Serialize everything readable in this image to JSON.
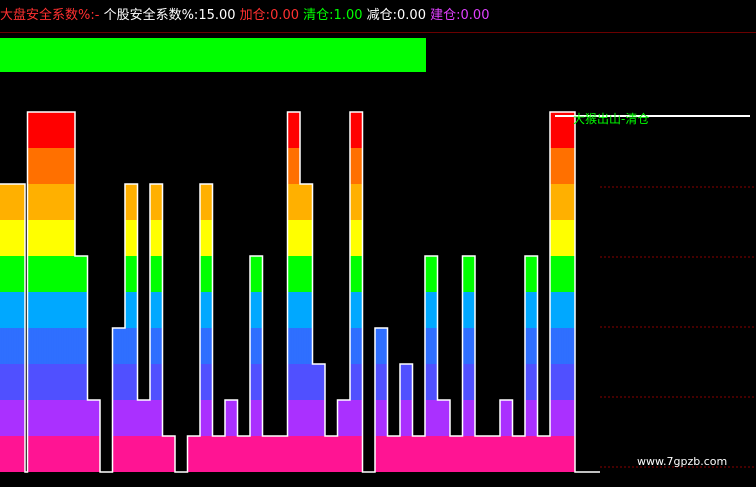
{
  "header": {
    "item1": {
      "label": "大盘安全系数%:",
      "value": "-",
      "color": "#ff3030"
    },
    "item2": {
      "label": "个股安全系数%:",
      "value": "15.00",
      "color": "#ffffff"
    },
    "item3": {
      "label": "加仓:",
      "value": "0.00",
      "color": "#ff3030"
    },
    "item4": {
      "label": "清仓:",
      "value": "1.00",
      "color": "#00ff00"
    },
    "item5": {
      "label": "减仓:",
      "value": "0.00",
      "color": "#ffffff"
    },
    "item6": {
      "label": "建仓:",
      "value": "0.00",
      "color": "#e040ff"
    }
  },
  "top_bar_color": "#00ff00",
  "band_colors": [
    "#ff1493",
    "#aa30ff",
    "#5050ff",
    "#2f6fff",
    "#00a8ff",
    "#00ff00",
    "#ffff00",
    "#ffb000",
    "#ff7000",
    "#ff0000"
  ],
  "overlay_label": {
    "text": "大猴出山-清仓",
    "color": "#00ff00"
  },
  "watermark": "www.7gpzb.com",
  "chart_data": {
    "type": "bar",
    "levels_max": 10,
    "values": [
      8,
      8,
      8,
      8,
      8,
      8,
      8,
      8,
      8,
      8,
      8,
      8,
      8,
      8,
      8,
      8,
      8,
      8,
      8,
      8,
      0,
      0,
      10,
      10,
      10,
      10,
      10,
      10,
      10,
      10,
      10,
      10,
      10,
      10,
      10,
      10,
      10,
      10,
      10,
      10,
      10,
      10,
      10,
      10,
      10,
      10,
      10,
      10,
      10,
      10,
      10,
      10,
      10,
      10,
      10,
      10,
      10,
      10,
      10,
      10,
      6,
      6,
      6,
      6,
      6,
      6,
      6,
      6,
      6,
      6,
      2,
      2,
      2,
      2,
      2,
      2,
      2,
      2,
      2,
      2,
      0,
      0,
      0,
      0,
      0,
      0,
      0,
      0,
      0,
      0,
      4,
      4,
      4,
      4,
      4,
      4,
      4,
      4,
      4,
      4,
      8,
      8,
      8,
      8,
      8,
      8,
      8,
      8,
      8,
      8,
      2,
      2,
      2,
      2,
      2,
      2,
      2,
      2,
      2,
      2,
      8,
      8,
      8,
      8,
      8,
      8,
      8,
      8,
      8,
      8,
      1,
      1,
      1,
      1,
      1,
      1,
      1,
      1,
      1,
      1,
      0,
      0,
      0,
      0,
      0,
      0,
      0,
      0,
      0,
      0,
      1,
      1,
      1,
      1,
      1,
      1,
      1,
      1,
      1,
      1,
      8,
      8,
      8,
      8,
      8,
      8,
      8,
      8,
      8,
      8,
      1,
      1,
      1,
      1,
      1,
      1,
      1,
      1,
      1,
      1,
      2,
      2,
      2,
      2,
      2,
      2,
      2,
      2,
      2,
      2,
      1,
      1,
      1,
      1,
      1,
      1,
      1,
      1,
      1,
      1,
      6,
      6,
      6,
      6,
      6,
      6,
      6,
      6,
      6,
      6,
      1,
      1,
      1,
      1,
      1,
      1,
      1,
      1,
      1,
      1,
      1,
      1,
      1,
      1,
      1,
      1,
      1,
      1,
      1,
      1,
      10,
      10,
      10,
      10,
      10,
      10,
      10,
      10,
      10,
      10,
      8,
      8,
      8,
      8,
      8,
      8,
      8,
      8,
      8,
      8,
      3,
      3,
      3,
      3,
      3,
      3,
      3,
      3,
      3,
      3,
      1,
      1,
      1,
      1,
      1,
      1,
      1,
      1,
      1,
      1,
      2,
      2,
      2,
      2,
      2,
      2,
      2,
      2,
      2,
      2,
      10,
      10,
      10,
      10,
      10,
      10,
      10,
      10,
      10,
      10,
      0,
      0,
      0,
      0,
      0,
      0,
      0,
      0,
      0,
      0,
      4,
      4,
      4,
      4,
      4,
      4,
      4,
      4,
      4,
      4,
      1,
      1,
      1,
      1,
      1,
      1,
      1,
      1,
      1,
      1,
      3,
      3,
      3,
      3,
      3,
      3,
      3,
      3,
      3,
      3,
      1,
      1,
      1,
      1,
      1,
      1,
      1,
      1,
      1,
      1,
      6,
      6,
      6,
      6,
      6,
      6,
      6,
      6,
      6,
      6,
      2,
      2,
      2,
      2,
      2,
      2,
      2,
      2,
      2,
      2,
      1,
      1,
      1,
      1,
      1,
      1,
      1,
      1,
      1,
      1,
      6,
      6,
      6,
      6,
      6,
      6,
      6,
      6,
      6,
      6,
      1,
      1,
      1,
      1,
      1,
      1,
      1,
      1,
      1,
      1,
      1,
      1,
      1,
      1,
      1,
      1,
      1,
      1,
      1,
      1,
      2,
      2,
      2,
      2,
      2,
      2,
      2,
      2,
      2,
      2,
      1,
      1,
      1,
      1,
      1,
      1,
      1,
      1,
      1,
      1,
      6,
      6,
      6,
      6,
      6,
      6,
      6,
      6,
      6,
      6,
      1,
      1,
      1,
      1,
      1,
      1,
      1,
      1,
      1,
      1,
      10,
      10,
      10,
      10,
      10,
      10,
      10,
      10,
      10,
      10,
      10,
      10,
      10,
      10,
      10,
      10,
      10,
      10,
      10,
      10,
      0,
      0,
      0,
      0,
      0,
      0,
      0,
      0,
      0,
      0,
      0,
      0,
      0,
      0,
      0,
      0,
      0,
      0,
      0,
      0
    ],
    "top_sections": [
      {
        "from": 0,
        "to": 20,
        "level": 10
      },
      {
        "from": 52,
        "to": 106,
        "level": 10
      },
      {
        "from": 205,
        "to": 265,
        "level": 10
      },
      {
        "from": 308,
        "to": 348,
        "level": 10
      },
      {
        "from": 565,
        "to": 590,
        "level": 10
      }
    ]
  }
}
